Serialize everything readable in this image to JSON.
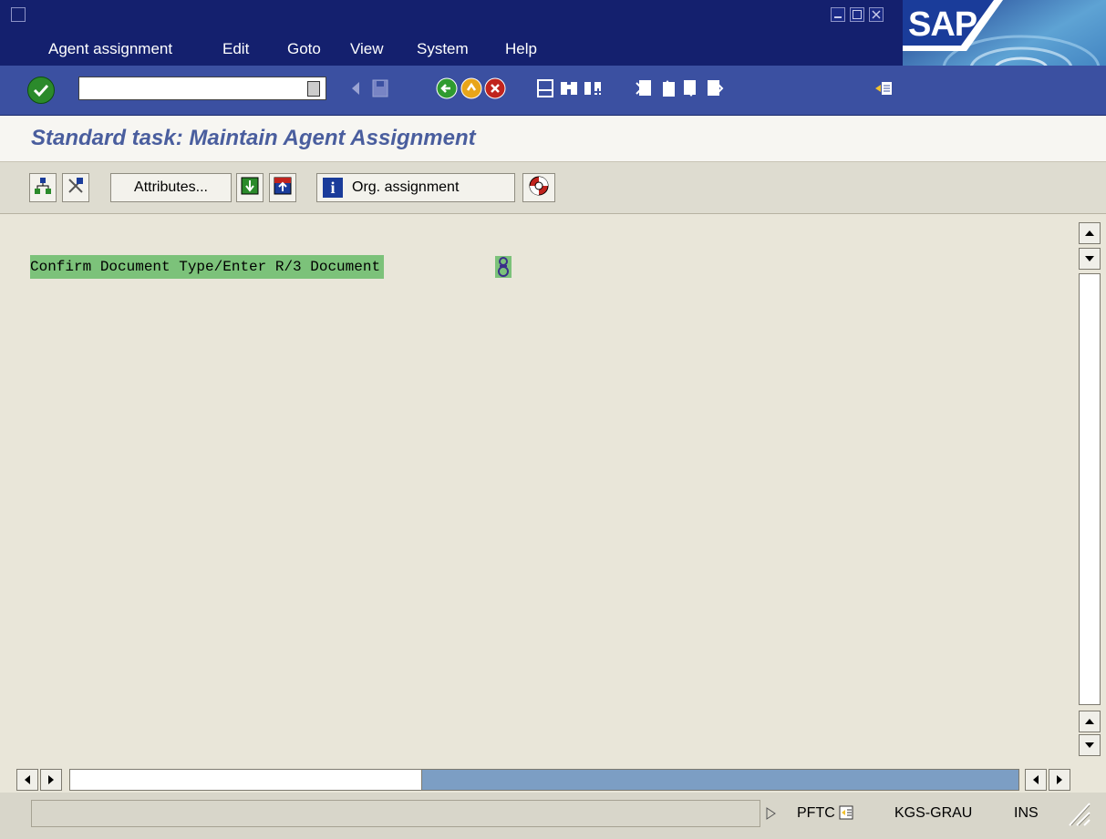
{
  "menubar": {
    "items": [
      {
        "label": "Agent assignment",
        "mnemonic": "A"
      },
      {
        "label": "Edit",
        "mnemonic": "E"
      },
      {
        "label": "Goto",
        "mnemonic": "G"
      },
      {
        "label": "View",
        "mnemonic": "i"
      },
      {
        "label": "System",
        "mnemonic": "y"
      },
      {
        "label": "Help",
        "mnemonic": "H"
      }
    ],
    "logo_text": "SAP"
  },
  "toolbar": {
    "command_field_value": "",
    "icons": [
      "enter-icon",
      "command-history-icon",
      "back-arrow-small-icon",
      "save-icon",
      "back-icon",
      "exit-icon",
      "cancel-icon",
      "print-icon",
      "find-icon",
      "find-next-icon",
      "first-page-icon",
      "previous-page-icon",
      "next-page-icon",
      "last-page-icon",
      "create-session-icon"
    ]
  },
  "page": {
    "title": "Standard task: Maintain Agent Assignment"
  },
  "app_toolbar": {
    "attributes_label": "Attributes...",
    "org_assignment_label": "Org. assignment",
    "icons": [
      "org-structure-icon",
      "delete-assignment-icon",
      "expand-icon",
      "collapse-icon",
      "info-icon",
      "help-lifebuoy-icon"
    ]
  },
  "content": {
    "tree_node": {
      "label": "Confirm Document Type/Enter R/3 Document",
      "icon": "agent-assignment-icon",
      "highlight_color": "#7cc27a"
    }
  },
  "statusbar": {
    "transaction": "PFTC",
    "system": "KGS-GRAU",
    "mode": "INS"
  },
  "colors": {
    "title_bar": "#14206e",
    "toolbar": "#3b50a1",
    "page_title_text": "#4a5e9e",
    "background": "#e9e6d9"
  }
}
